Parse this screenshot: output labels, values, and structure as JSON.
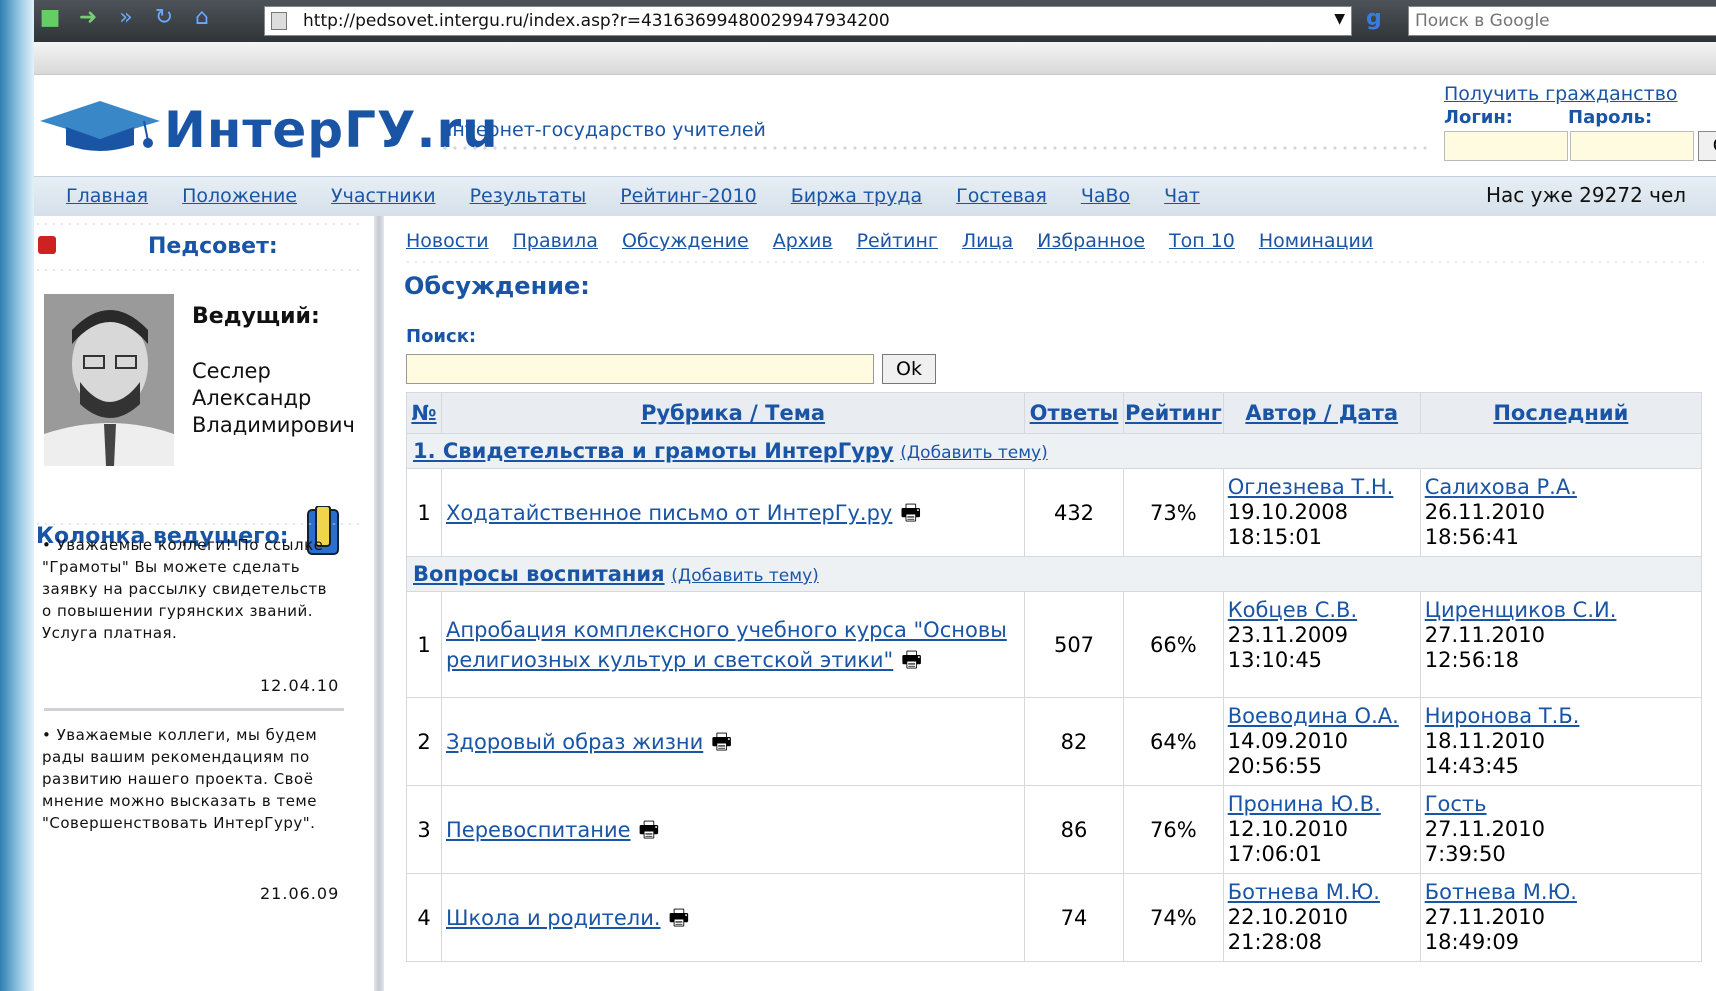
{
  "browser": {
    "url": "http://pedsovet.intergu.ru/index.asp?r=43163699480029947934200",
    "search_placeholder": "Поиск в Google"
  },
  "site": {
    "logo_text": "ИнтерГУ.ru",
    "tagline": "интернет-государство учителей",
    "citizenship_link": "Получить гражданство",
    "login_label": "Логин:",
    "password_label": "Пароль:",
    "ok_label": "Ok",
    "help_label": "?",
    "member_count": "Нас уже 29272 чел"
  },
  "main_nav": [
    "Главная",
    "Положение",
    "Участники",
    "Результаты",
    "Рейтинг-2010",
    "Биржа труда",
    "Гостевая",
    "ЧаВо",
    "Чат"
  ],
  "sidebar": {
    "title": "Педсовет:",
    "host_label": "Ведущий:",
    "host_name": [
      "Сеслер",
      "Александр",
      "Владимирович"
    ],
    "column_title": "Колонка ведущего:",
    "news": [
      {
        "text": "• Уважаемые коллеги! По ссылке \"Грамоты\" Вы можете сделать заявку на рассылку свидетельств о повышении гурянских званий. Услуга платная.",
        "date": "12.04.10"
      },
      {
        "text": "• Уважаемые коллеги, мы будем рады вашим рекомендациям по развитию нашего проекта. Своё мнение можно высказать в теме \"Совершенствовать ИнтерГуру\".",
        "date": "21.06.09"
      }
    ]
  },
  "sub_nav": [
    "Новости",
    "Правила",
    "Обсуждение",
    "Архив",
    "Рейтинг",
    "Лица",
    "Избранное",
    "Топ 10",
    "Номинации"
  ],
  "section_title": "Обсуждение:",
  "search": {
    "label": "Поиск:",
    "ok": "Ok"
  },
  "table": {
    "headers": {
      "num": "№",
      "rubric": "Рубрика / Тема",
      "answers": "Ответы",
      "rating": "Рейтинг",
      "author": "Автор / Дата",
      "last": "Последний"
    },
    "add_topic": "(Добавить тему)",
    "rubrics": [
      {
        "title": "1. Свидетельства и грамоты ИнтерГуру",
        "rows": [
          {
            "n": "1",
            "topic": "Ходатайственное письмо от ИнтерГу.ру",
            "answers": "432",
            "rating": "73%",
            "author": "Оглезнева Т.Н.",
            "author_date": "19.10.2008",
            "author_time": "18:15:01",
            "last": "Салихова Р.А.",
            "last_date": "26.11.2010",
            "last_time": "18:56:41"
          }
        ]
      },
      {
        "title": "Вопросы воспитания",
        "rows": [
          {
            "n": "1",
            "topic": "Апробация комплексного учебного курса \"Основы религиозных культур и светской этики\"",
            "answers": "507",
            "rating": "66%",
            "author": "Кобцев С.В.",
            "author_date": "23.11.2009",
            "author_time": "13:10:45",
            "last": "Циренщиков С.И.",
            "last_date": "27.11.2010",
            "last_time": "12:56:18"
          },
          {
            "n": "2",
            "topic": "Здоровый образ жизни",
            "answers": "82",
            "rating": "64%",
            "author": "Воеводина О.А.",
            "author_date": "14.09.2010",
            "author_time": "20:56:55",
            "last": "Ниронова Т.Б.",
            "last_date": "18.11.2010",
            "last_time": "14:43:45"
          },
          {
            "n": "3",
            "topic": "Перевоспитание",
            "answers": "86",
            "rating": "76%",
            "author": "Пронина Ю.В.",
            "author_date": "12.10.2010",
            "author_time": "17:06:01",
            "last": "Гость",
            "last_date": "27.11.2010",
            "last_time": "7:39:50"
          },
          {
            "n": "4",
            "topic": "Школа и родители.",
            "answers": "74",
            "rating": "74%",
            "author": "Ботнева М.Ю.",
            "author_date": "22.10.2010",
            "author_time": "21:28:08",
            "last": "Ботнева М.Ю.",
            "last_date": "27.11.2010",
            "last_time": "18:49:09"
          }
        ]
      }
    ]
  }
}
